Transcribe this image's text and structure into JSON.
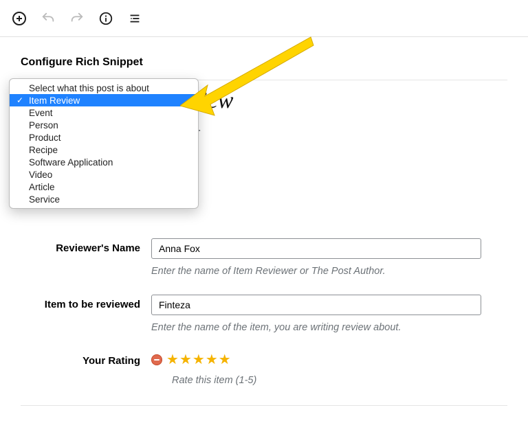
{
  "section_title": "Configure Rich Snippet",
  "dropdown": {
    "items": [
      "Select what this post is about",
      "Item Review",
      "Event",
      "Person",
      "Product",
      "Recipe",
      "Software Application",
      "Video",
      "Article",
      "Service"
    ],
    "selected_index": 1
  },
  "partial_heading": "eview",
  "partial_help": "tion.",
  "form": {
    "reviewer_label": "Reviewer's Name",
    "reviewer_value": "Anna Fox",
    "reviewer_help": "Enter the name of Item Reviewer or The Post Author.",
    "item_label": "Item to be reviewed",
    "item_value": "Finteza",
    "item_help": "Enter the name of the item, you are writing review about.",
    "rating_label": "Your Rating",
    "rating_value": 5,
    "rating_help": "Rate this item (1-5)"
  }
}
